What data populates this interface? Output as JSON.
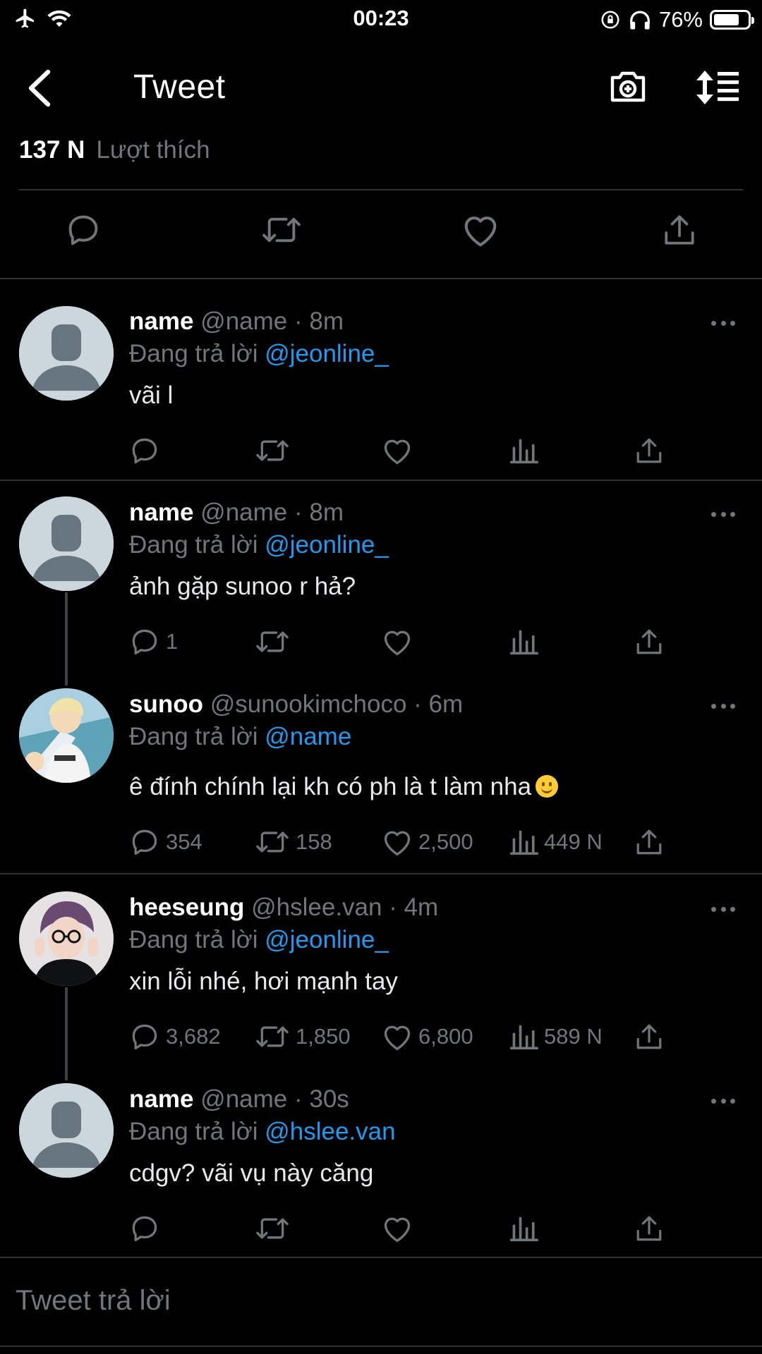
{
  "status_bar": {
    "time": "00:23",
    "battery": "76%"
  },
  "header": {
    "title": "Tweet"
  },
  "likes": {
    "count": "137 N",
    "label": "Lượt thích"
  },
  "tweets": [
    {
      "name": "name",
      "meta": "@name · 8m",
      "reply_prefix": "Đang trả lời",
      "reply_to": "@jeonline_",
      "text": "vãi l",
      "reply_count": "",
      "retweet_count": "",
      "like_count": "",
      "view_count": ""
    },
    {
      "name": "name",
      "meta": "@name · 8m",
      "reply_prefix": "Đang trả lời",
      "reply_to": "@jeonline_",
      "text": "ảnh gặp sunoo r hả?",
      "reply_count": "1",
      "retweet_count": "",
      "like_count": "",
      "view_count": ""
    },
    {
      "name": "sunoo",
      "meta": "@sunookimchoco · 6m",
      "reply_prefix": "Đang trả lời",
      "reply_to": "@name",
      "text": "ê đính chính lại kh có ph là t làm nha",
      "reply_count": "354",
      "retweet_count": "158",
      "like_count": "2,500",
      "view_count": "449 N"
    },
    {
      "name": "heeseung",
      "meta": "@hslee.van · 4m",
      "reply_prefix": "Đang trả lời",
      "reply_to": "@jeonline_",
      "text": "xin lỗi nhé, hơi mạnh tay",
      "reply_count": "3,682",
      "retweet_count": "1,850",
      "like_count": "6,800",
      "view_count": "589 N"
    },
    {
      "name": "name",
      "meta": "@name · 30s",
      "reply_prefix": "Đang trả lời",
      "reply_to": "@hslee.van",
      "text": "cdgv? vãi vụ này căng",
      "reply_count": "",
      "retweet_count": "",
      "like_count": "",
      "view_count": ""
    }
  ],
  "composer": {
    "placeholder": "Tweet trả lời"
  },
  "colors": {
    "background": "#000000",
    "muted": "#71767b",
    "link": "#1d9bf0",
    "divider": "#2f3336"
  }
}
